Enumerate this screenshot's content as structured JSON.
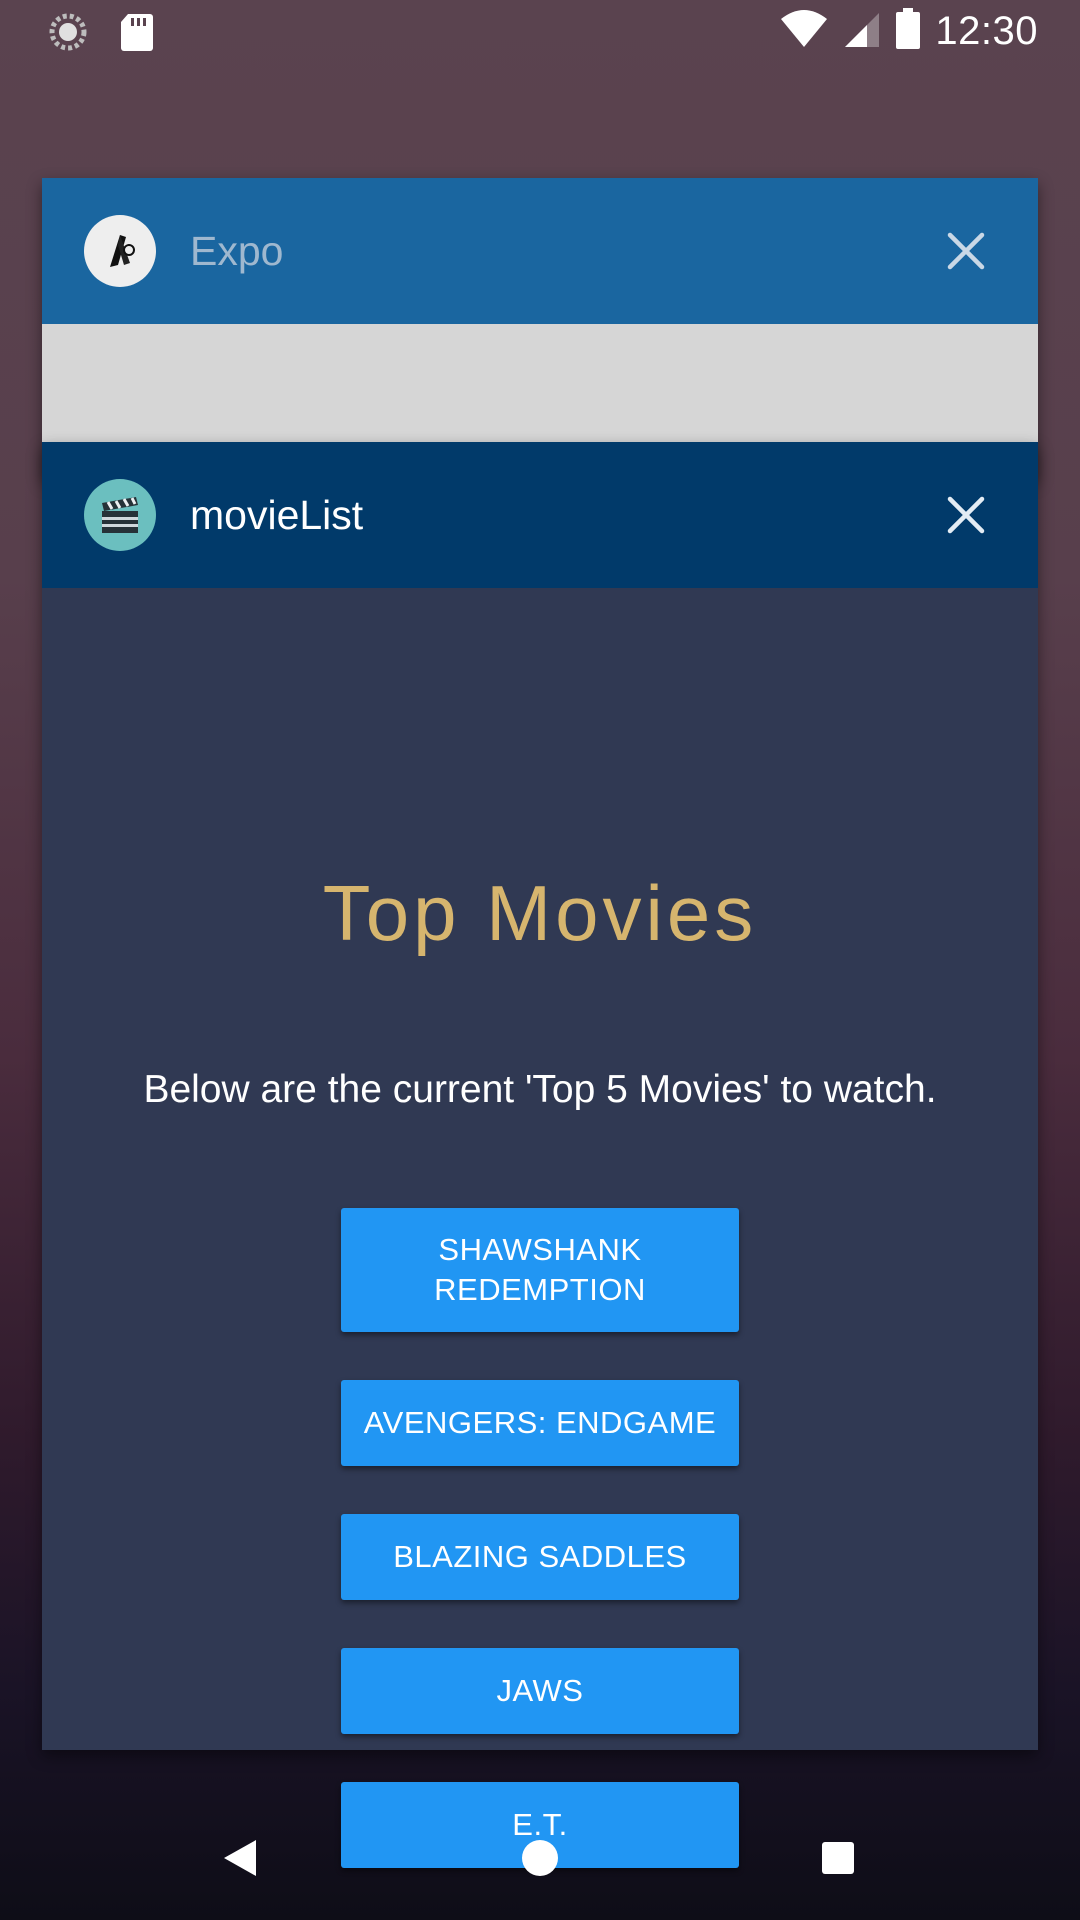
{
  "status_bar": {
    "time": "12:30",
    "icons": [
      "sync-icon",
      "sd-card-icon",
      "wifi-icon",
      "cell-signal-icon",
      "battery-icon"
    ]
  },
  "recents": {
    "expo_card": {
      "app_name": "Expo",
      "icon": "expo-logo-icon",
      "header_color": "#1a66a0"
    },
    "movie_card": {
      "app_name": "movieList",
      "icon": "clapperboard-icon",
      "header_color": "#013a6a",
      "content": {
        "title": "Top Movies",
        "subtitle": "Below are the current 'Top 5 Movies' to watch.",
        "movies": [
          {
            "label": "SHAWSHANK REDEMPTION"
          },
          {
            "label": "AVENGERS: ENDGAME"
          },
          {
            "label": "BLAZING SADDLES"
          },
          {
            "label": "JAWS"
          },
          {
            "label": "E.T."
          }
        ],
        "accent_color": "#d6b56e",
        "button_color": "#2196f3",
        "background_color": "#303953"
      }
    }
  },
  "nav_bar": {
    "icons": [
      "back-icon",
      "home-icon",
      "recents-icon"
    ]
  }
}
